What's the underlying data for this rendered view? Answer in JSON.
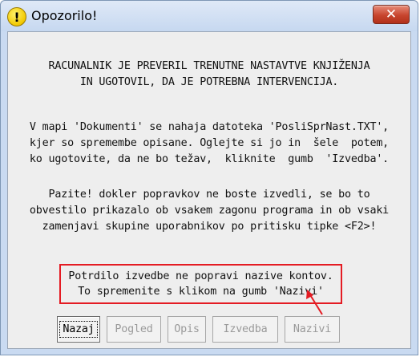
{
  "window": {
    "title": "Opozorilo!",
    "close_symbol": "✕",
    "icon": "warning-icon",
    "icon_symbol": "!"
  },
  "message": {
    "p1": "RACUNALNIK JE PREVERIL TRENUTNE NASTAVTVE KNJIŽENJA\nIN UGOTOVIL, DA JE POTREBNA INTERVENCIJA.",
    "p2": "V mapi 'Dokumenti' se nahaja datoteka 'PosliSprNast.TXT',\nkjer so spremembe opisane. Oglejte si jo in  šele  potem,\nko ugotovite, da ne bo težav,  kliknite  gumb  'Izvedba'.",
    "p3": "Pazite! dokler popravkov ne boste izvedli, se bo to\nobvestilo prikazalo ob vsakem zagonu programa in ob vsaki\nzamenjavi skupine uporabnikov po pritisku tipke <F2>!",
    "notice": "Potrdilo izvedbe ne popravi nazive kontov.\nTo spremenite s klikom na gumb 'Nazivi'"
  },
  "buttons": {
    "nazaj": "Nazaj",
    "pogled": "Pogled",
    "opis": "Opis",
    "izvedba": "Izvedba",
    "nazivi": "Nazivi"
  },
  "colors": {
    "highlight": "#e41b23",
    "title_bar": "#c6d8f0",
    "close_button": "#c7452e"
  }
}
